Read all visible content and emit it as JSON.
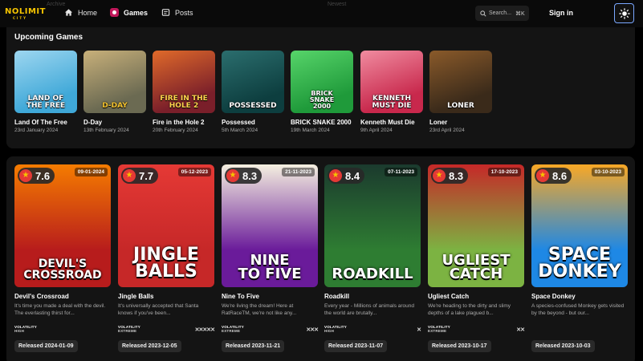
{
  "nav": {
    "logo_main": "NOLIMIT",
    "logo_sub": "CITY",
    "home": "Home",
    "games": "Games",
    "posts": "Posts",
    "faint_left": "Archive",
    "faint_mid": "Newest",
    "search_placeholder": "Search...",
    "search_shortcut": "⌘K",
    "signin": "Sign in",
    "icons": {
      "home": "home-icon",
      "games": "games-icon",
      "posts": "posts-icon",
      "search": "search-icon",
      "theme": "sun-icon"
    }
  },
  "upcoming": {
    "title": "Upcoming Games",
    "items": [
      {
        "name": "Land Of The Free",
        "date": "23rd January 2024",
        "art": "LAND OF\nTHE FREE",
        "bg": "#3fa8d8",
        "bg2": "#9dd6f0",
        "art_color": "#fff"
      },
      {
        "name": "D-Day",
        "date": "13th February 2024",
        "art": "D-DAY",
        "bg": "#6b6a52",
        "bg2": "#c8b07a",
        "art_color": "#f2c230"
      },
      {
        "name": "Fire in the Hole 2",
        "date": "20th February 2024",
        "art": "FIRE IN THE\nHOLE 2",
        "bg": "#7a1f2a",
        "bg2": "#e06a2a",
        "art_color": "#ffd34d"
      },
      {
        "name": "Possessed",
        "date": "5th March 2024",
        "art": "POSSESSED",
        "bg": "#0d3e3f",
        "bg2": "#2b6e6e",
        "art_color": "#fff"
      },
      {
        "name": "BRICK SNAKE 2000",
        "date": "19th March 2024",
        "art": "BRICK\nSNAKE\n2000",
        "bg": "#1f9a3a",
        "bg2": "#57d46a",
        "art_color": "#fff"
      },
      {
        "name": "Kenneth Must Die",
        "date": "9th April 2024",
        "art": "KENNETH\nMUST DIE",
        "bg": "#c8284c",
        "bg2": "#f08ca0",
        "art_color": "#fff"
      },
      {
        "name": "Loner",
        "date": "23rd April 2024",
        "art": "LONER",
        "bg": "#3a2a1a",
        "bg2": "#8a5a2a",
        "art_color": "#fff"
      }
    ]
  },
  "games": [
    {
      "name": "Devil's Crossroad",
      "date_pill": "09-01-2024",
      "rating": "7.6",
      "art": "DEVIL'S\nCROSSROAD",
      "bg": "#b71c1c",
      "bg2": "#f57c00",
      "desc": "It's time you made a deal with the devil. The everlasting thirst for...",
      "vol_line1": "VOLATILITY",
      "vol_line2": "HIGH",
      "xs": "",
      "released": "Released 2024-01-09"
    },
    {
      "name": "Jingle Balls",
      "date_pill": "05-12-2023",
      "rating": "7.7",
      "art": "JINGLE\nBALLS",
      "bg": "#c62828",
      "bg2": "#e53935",
      "desc": "It's universally accepted that Santa knows if you've been...",
      "vol_line1": "VOLATILITY",
      "vol_line2": "EXTREME",
      "xs": "✕✕✕✕✕",
      "released": "Released 2023-12-05"
    },
    {
      "name": "Nine To Five",
      "date_pill": "21-11-2023",
      "rating": "8.3",
      "art": "NINE\nTO FIVE",
      "bg": "#6a1b9a",
      "bg2": "#f5f0e0",
      "desc": "We're living the dream! Here at RatRaceTM, we're not like any...",
      "vol_line1": "VOLATILITY",
      "vol_line2": "EXTREME",
      "xs": "✕✕✕",
      "released": "Released 2023-11-21"
    },
    {
      "name": "Roadkill",
      "date_pill": "07-11-2023",
      "rating": "8.4",
      "art": "ROADKILL",
      "bg": "#2e7d32",
      "bg2": "#1b3a2e",
      "desc": "Every year - Millions of animals around the world are brutally...",
      "vol_line1": "VOLATILITY",
      "vol_line2": "HIGH",
      "xs": "✕",
      "released": "Released 2023-11-07"
    },
    {
      "name": "Ugliest Catch",
      "date_pill": "17-10-2023",
      "rating": "8.3",
      "art": "UGLIEST\nCATCH",
      "bg": "#7cb342",
      "bg2": "#c62828",
      "desc": "We're heading to the dirty and slimy depths of a lake plagued b...",
      "vol_line1": "VOLATILITY",
      "vol_line2": "EXTREME",
      "xs": "✕✕",
      "released": "Released 2023-10-17"
    },
    {
      "name": "Space Donkey",
      "date_pill": "03-10-2023",
      "rating": "8.6",
      "art": "SPACE\nDONKEY",
      "bg": "#1e88e5",
      "bg2": "#f9a825",
      "desc": "A species-confused Monkey gets visited by the beyond - but our...",
      "vol_line1": "",
      "vol_line2": "",
      "xs": "",
      "released": "Released 2023-10-03"
    }
  ]
}
